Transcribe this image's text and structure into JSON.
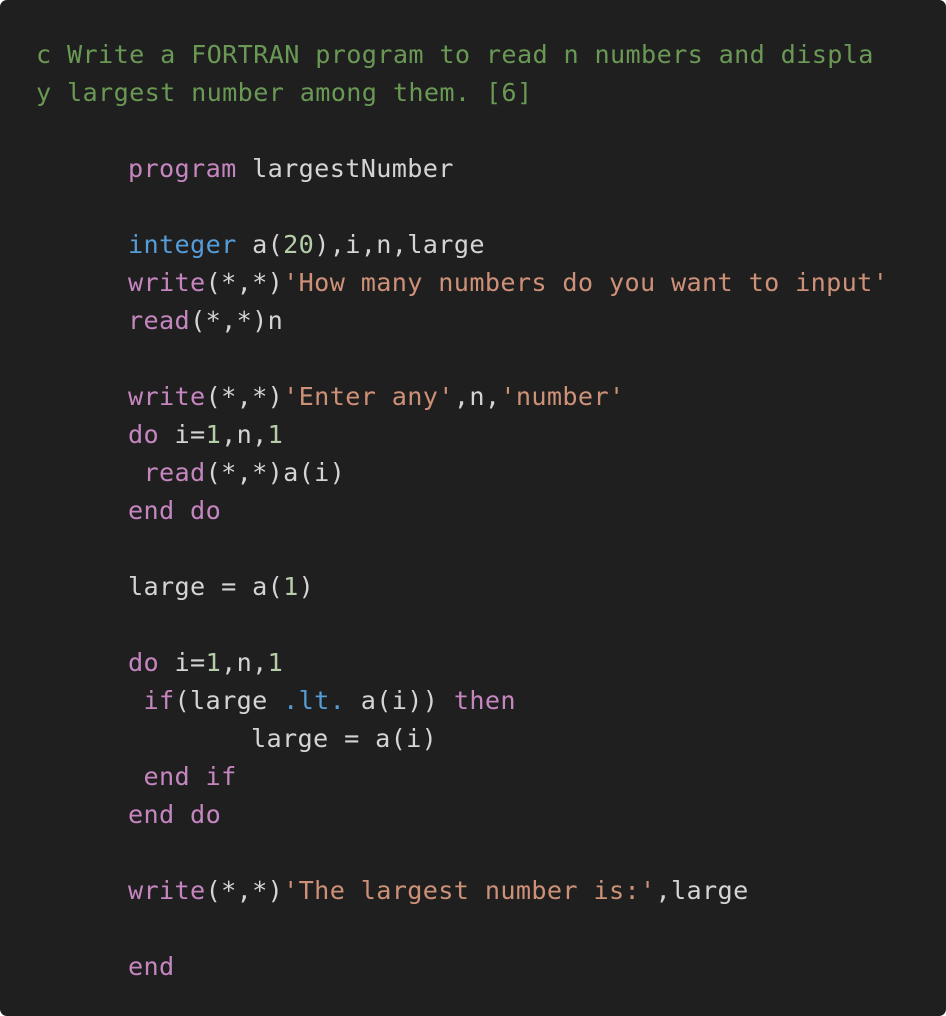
{
  "theme": {
    "background": "#1f1f1f",
    "comment": "#6a9955",
    "keyword": "#c586c0",
    "type": "#569cd6",
    "string": "#ce9178",
    "number": "#b5cea8",
    "text": "#d4d4d4"
  },
  "code": {
    "comment_line1": "c Write a FORTRAN program to read n numbers and displa",
    "comment_line2": "y largest number among them. [6]",
    "l_program": {
      "kw": "program",
      "rest": " largestNumber"
    },
    "l_integer": {
      "type": "integer",
      "a": " a(",
      "num": "20",
      "rest": "),i,n,large"
    },
    "l_write1": {
      "kw": "write",
      "args": "(*,*)",
      "str": "'How many numbers do you want to input'"
    },
    "l_read1": {
      "kw": "read",
      "rest": "(*,*)n"
    },
    "l_write2": {
      "kw": "write",
      "args": "(*,*)",
      "str1": "'Enter any'",
      "mid": ",n,",
      "str2": "'number'"
    },
    "l_do1": {
      "kw": "do",
      "a": " i=",
      "n1": "1",
      "b": ",n,",
      "n2": "1"
    },
    "l_read2": {
      "kw": "read",
      "rest": "(*,*)a(i)"
    },
    "l_enddo1": "end do",
    "l_large1": {
      "a": "large = a(",
      "num": "1",
      "b": ")"
    },
    "l_do2": {
      "kw": "do",
      "a": " i=",
      "n1": "1",
      "b": ",n,",
      "n2": "1"
    },
    "l_if": {
      "kw": "if",
      "a": "(large ",
      "op": ".lt.",
      "b": " a(i)) ",
      "kw2": "then"
    },
    "l_large2": "large = a(i)",
    "l_endif": "end if",
    "l_enddo2": "end do",
    "l_write3": {
      "kw": "write",
      "args": "(*,*)",
      "str": "'The largest number is:'",
      "rest": ",large"
    },
    "l_end": "end"
  }
}
